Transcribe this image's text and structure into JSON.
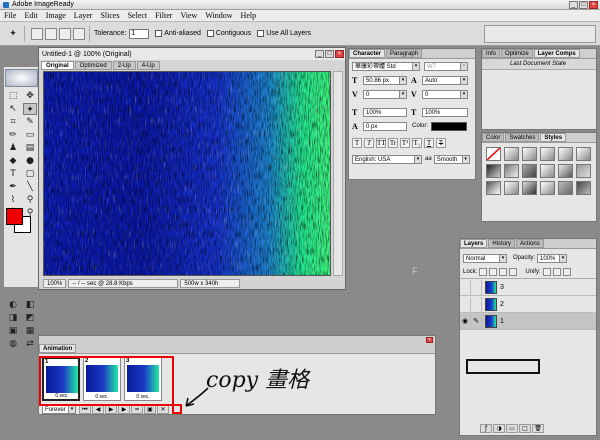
{
  "window": {
    "title": "Adobe ImageReady"
  },
  "menu": [
    "File",
    "Edit",
    "Image",
    "Layer",
    "Slices",
    "Select",
    "Filter",
    "View",
    "Window",
    "Help"
  ],
  "options_bar": {
    "tolerance_label": "Tolerance:",
    "tolerance_value": "1",
    "anti_aliased_label": "Anti-aliased",
    "contiguous_label": "Contiguous",
    "use_all_layers_label": "Use All Layers"
  },
  "document": {
    "title": "Untitled-1 @ 100% (Original)",
    "tabs": [
      "Original",
      "Optimized",
      "2-Up",
      "4-Up"
    ],
    "active_tab": "Original",
    "zoom": "100%",
    "download_time": "-- / -- sec @ 28.8 Kbps",
    "dimensions": "500w x 340h"
  },
  "character_panel": {
    "tabs": [
      "Character",
      "Paragraph"
    ],
    "font_family": "華康彩帶體 Std",
    "font_style": "W7",
    "font_size": "50.86 px",
    "leading": "Auto",
    "kerning": "0",
    "tracking": "0",
    "vertical_scale": "100%",
    "horizontal_scale": "100%",
    "baseline_shift": "0 px",
    "color_label": "Color:",
    "style_buttons": [
      "T",
      "T",
      "TT",
      "Tr",
      "T¹",
      "T₁",
      "T",
      "T"
    ],
    "language": "English: USA",
    "antialias": "Smooth",
    "antialias_prefix": "aa"
  },
  "info_panel": {
    "tabs": [
      "Info",
      "Optimize",
      "Layer Comps"
    ],
    "active_tab": "Layer Comps",
    "item": "Last Document State"
  },
  "styles_panel": {
    "tabs": [
      "Color",
      "Swatches",
      "Styles"
    ],
    "active_tab": "Styles"
  },
  "layers_panel": {
    "tabs": [
      "Layers",
      "History",
      "Actions"
    ],
    "active_tab": "Layers",
    "blend_mode": "Normal",
    "opacity_label": "Opacity:",
    "opacity": "100%",
    "lock_label": "Lock:",
    "unify_label": "Unify:",
    "layers": [
      {
        "name": "3",
        "visible": false,
        "selected": false
      },
      {
        "name": "2",
        "visible": false,
        "selected": false
      },
      {
        "name": "1",
        "visible": true,
        "selected": true
      }
    ]
  },
  "animation_panel": {
    "title": "Animation",
    "frames": [
      {
        "number": "1",
        "delay": "0 sec."
      },
      {
        "number": "2",
        "delay": "0 sec."
      },
      {
        "number": "3",
        "delay": "0 sec."
      }
    ],
    "loop": "Forever"
  },
  "annotation": {
    "handwritten_text": "copy 畫格",
    "stroke_color": "#e00000"
  },
  "colors": {
    "foreground": "#e00000",
    "background": "#ffffff",
    "text_color_swatch": "#000000"
  },
  "stray_label": "F"
}
